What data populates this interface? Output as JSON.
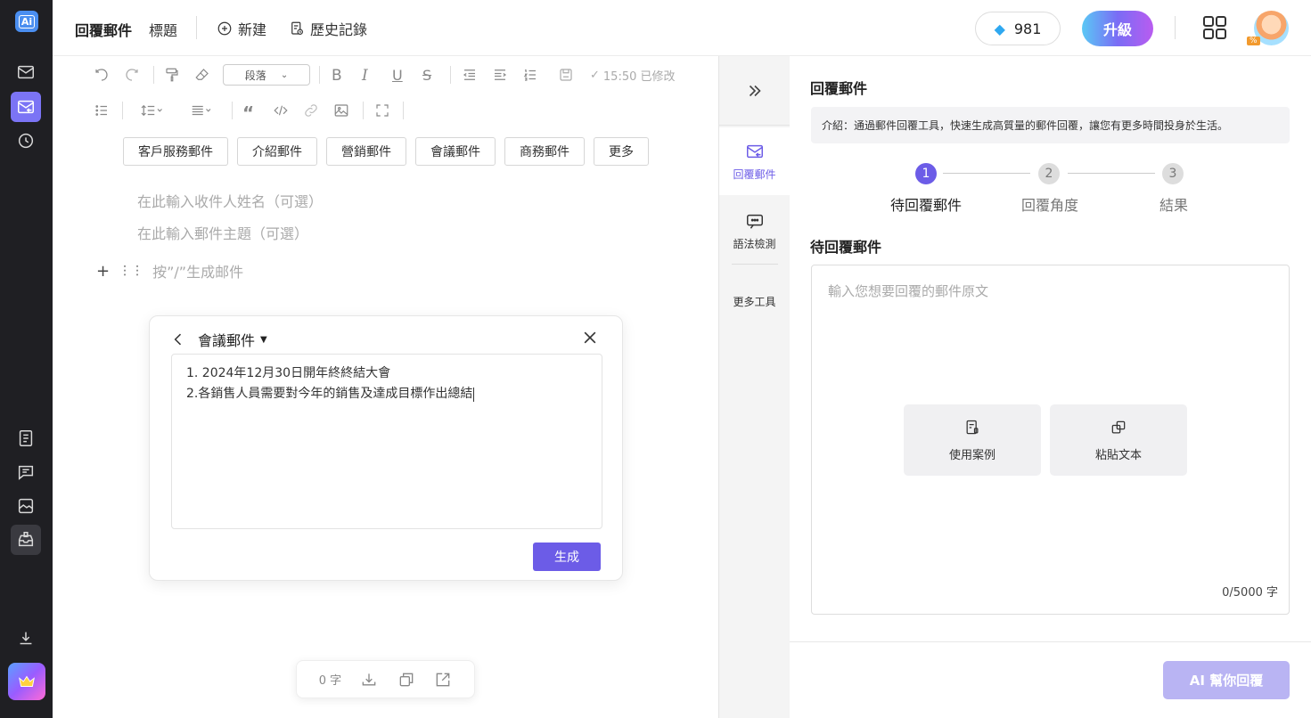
{
  "rail": {
    "logo_text": "Ai",
    "items": [
      "mail-icon",
      "reply-mail-icon",
      "history-icon"
    ],
    "bottom_items": [
      "note-icon",
      "chat-icon",
      "image-icon",
      "inbox-icon"
    ]
  },
  "topbar": {
    "title": "回覆郵件",
    "subtitle": "標題",
    "new_label": "新建",
    "history_label": "歷史記錄",
    "credits": "981",
    "upgrade_label": "升級",
    "avatar_badge": "%"
  },
  "editor": {
    "paragraph_select": "段落",
    "saved_status": "15:50 已修改",
    "categories": [
      "客戶服務郵件",
      "介紹郵件",
      "營銷郵件",
      "會議郵件",
      "商務郵件",
      "更多"
    ],
    "recipient_placeholder": "在此輸入收件人姓名（可選）",
    "subject_placeholder": "在此輸入郵件主題（可選）",
    "slash_hint": "按”/”生成邮件"
  },
  "popup": {
    "title": "會議郵件",
    "line1": "1. 2024年12月30日開年終終結大會",
    "line2": "2.各銷售人員需要對今年的銷售及達成目標作出總結",
    "generate_label": "生成"
  },
  "bottombar": {
    "word_count": "0 字"
  },
  "midcol": {
    "reply_label": "回覆郵件",
    "grammar_label": "語法檢測",
    "more_label": "更多工具"
  },
  "panel": {
    "title": "回覆郵件",
    "intro": "介紹：通過郵件回覆工具，快速生成高質量的郵件回覆，讓您有更多時間投身於生活。",
    "steps": [
      {
        "num": "1",
        "label": "待回覆郵件"
      },
      {
        "num": "2",
        "label": "回覆角度"
      },
      {
        "num": "3",
        "label": "結果"
      }
    ],
    "section_title": "待回覆郵件",
    "input_placeholder": "輸入您想要回覆的郵件原文",
    "use_example_label": "使用案例",
    "paste_label": "粘貼文本",
    "char_count": "0/5000 字",
    "ai_button": "AI 幫你回覆"
  },
  "colors": {
    "accent": "#6c5ce7",
    "rail_bg": "#1f1f23",
    "ai_button_disabled": "#b9b4f3"
  }
}
